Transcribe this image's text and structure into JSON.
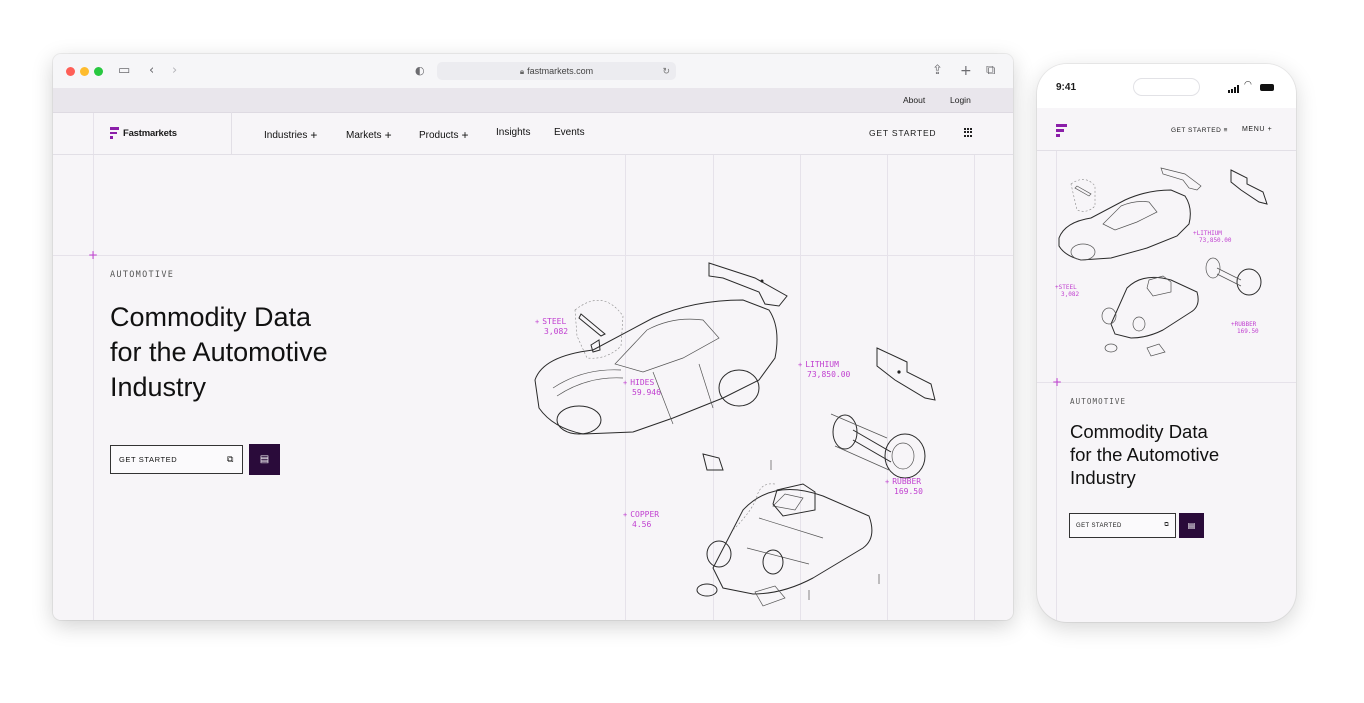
{
  "browser": {
    "url": "fastmarkets.com"
  },
  "site": {
    "top_links": {
      "about": "About",
      "login": "Login"
    },
    "logo_text": "Fastmarkets",
    "nav": [
      {
        "label": "Industries",
        "has_plus": true
      },
      {
        "label": "Markets",
        "has_plus": true
      },
      {
        "label": "Products",
        "has_plus": true
      },
      {
        "label": "Insights",
        "has_plus": false
      },
      {
        "label": "Events",
        "has_plus": false
      }
    ],
    "nav_cta": "GET STARTED",
    "hero": {
      "eyebrow": "AUTOMOTIVE",
      "title_lines": [
        "Commodity Data",
        "for the Automotive",
        "Industry"
      ],
      "cta_label": "GET STARTED"
    },
    "tags": [
      {
        "name": "STEEL",
        "value": "3,082"
      },
      {
        "name": "HIDES",
        "value": "59.946"
      },
      {
        "name": "LITHIUM",
        "value": "73,850.00"
      },
      {
        "name": "RUBBER",
        "value": "169.50"
      },
      {
        "name": "COPPER",
        "value": "4.56"
      }
    ]
  },
  "phone": {
    "time": "9:41",
    "cta": "GET STARTED",
    "menu": "MENU",
    "hero": {
      "eyebrow": "AUTOMOTIVE",
      "title_lines": [
        "Commodity Data",
        "for the Automotive",
        "Industry"
      ],
      "cta_label": "GET STARTED"
    },
    "tags": [
      {
        "name": "LITHIUM",
        "value": "73,850.00"
      },
      {
        "name": "STEEL",
        "value": "3,082"
      },
      {
        "name": "RUBBER",
        "value": "169.50"
      }
    ]
  },
  "colors": {
    "accent": "#c03fd0",
    "brand": "#8b1fa9",
    "dark_button": "#2a0b3a",
    "page_bg": "#f7f5f8"
  }
}
